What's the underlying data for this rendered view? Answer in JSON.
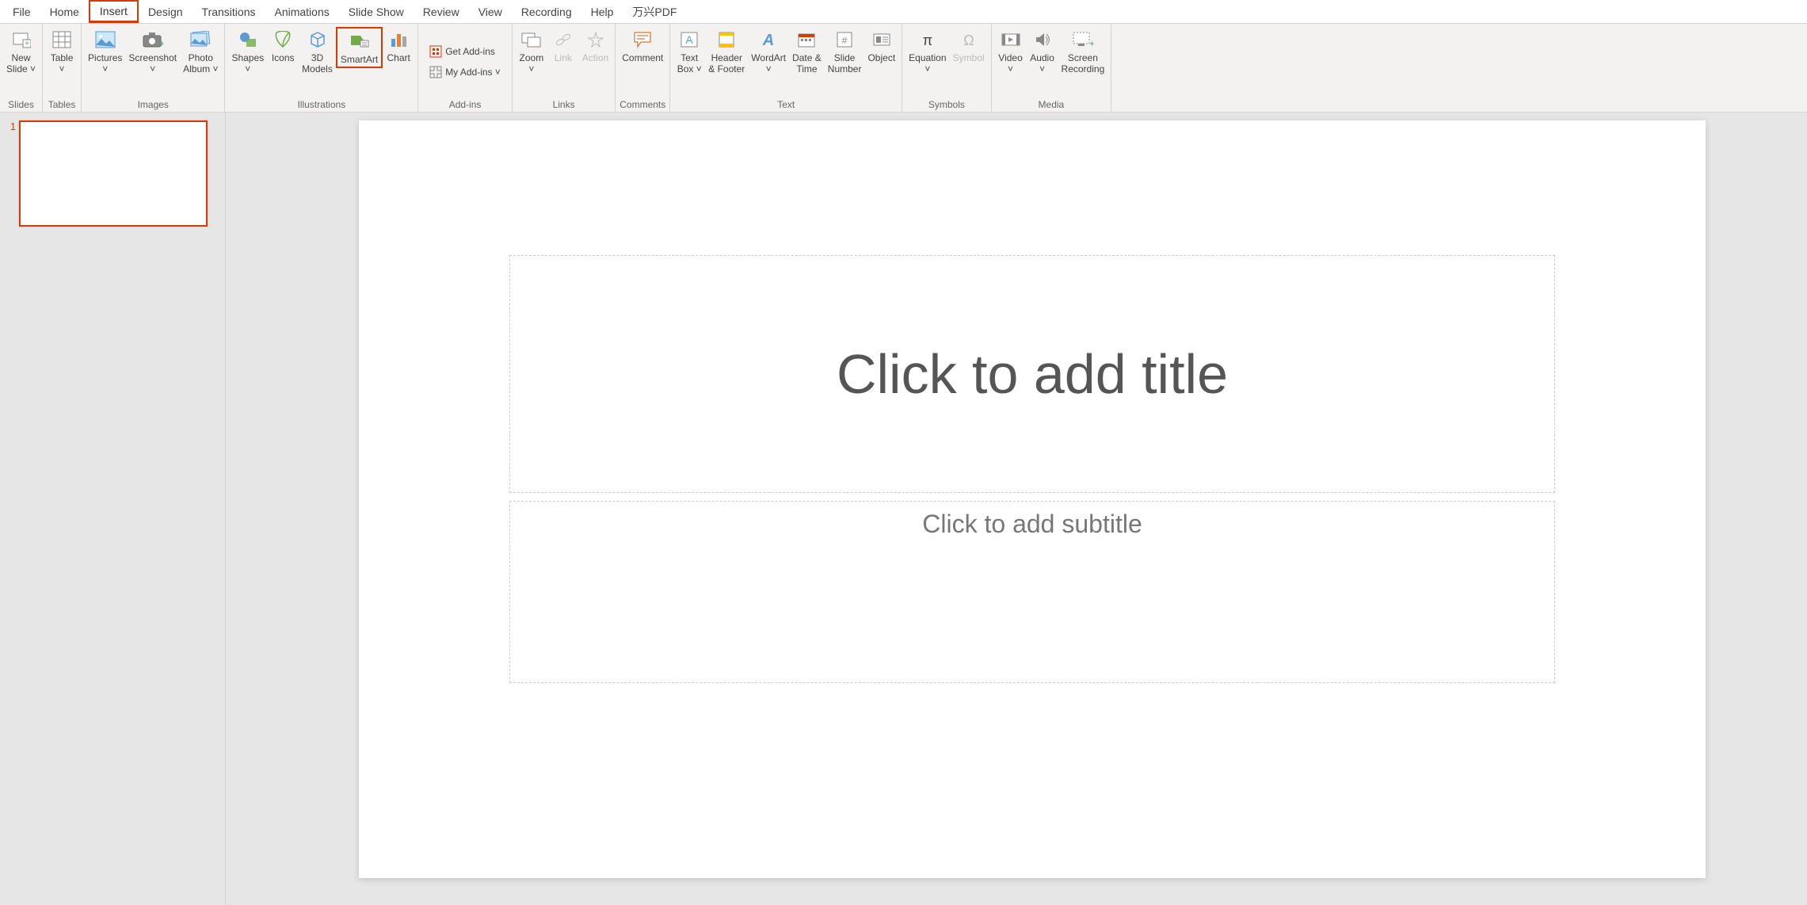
{
  "tabs": {
    "file": "File",
    "home": "Home",
    "insert": "Insert",
    "design": "Design",
    "transitions": "Transitions",
    "animations": "Animations",
    "slideshow": "Slide Show",
    "review": "Review",
    "view": "View",
    "recording": "Recording",
    "help": "Help",
    "wanxing": "万兴PDF"
  },
  "groups": {
    "slides": {
      "label": "Slides",
      "new_slide": "New\nSlide ˅"
    },
    "tables": {
      "label": "Tables",
      "table": "Table\n˅"
    },
    "images": {
      "label": "Images",
      "pictures": "Pictures\n˅",
      "screenshot": "Screenshot\n˅",
      "photo_album": "Photo\nAlbum ˅"
    },
    "illustrations": {
      "label": "Illustrations",
      "shapes": "Shapes\n˅",
      "icons": "Icons",
      "models": "3D\nModels",
      "smartart": "SmartArt",
      "chart": "Chart"
    },
    "addins": {
      "label": "Add-ins",
      "get": "Get Add-ins",
      "my": "My Add-ins  ˅"
    },
    "links": {
      "label": "Links",
      "zoom": "Zoom\n˅",
      "link": "Link",
      "action": "Action"
    },
    "comments": {
      "label": "Comments",
      "comment": "Comment"
    },
    "text": {
      "label": "Text",
      "textbox": "Text\nBox ˅",
      "header": "Header\n& Footer",
      "wordart": "WordArt\n˅",
      "datetime": "Date &\nTime",
      "slidenum": "Slide\nNumber",
      "object": "Object"
    },
    "symbols": {
      "label": "Symbols",
      "equation": "Equation\n˅",
      "symbol": "Symbol"
    },
    "media": {
      "label": "Media",
      "video": "Video\n˅",
      "audio": "Audio\n˅",
      "screen": "Screen\nRecording"
    }
  },
  "slide_panel": {
    "num": "1"
  },
  "editor": {
    "title_placeholder": "Click to add title",
    "subtitle_placeholder": "Click to add subtitle"
  }
}
